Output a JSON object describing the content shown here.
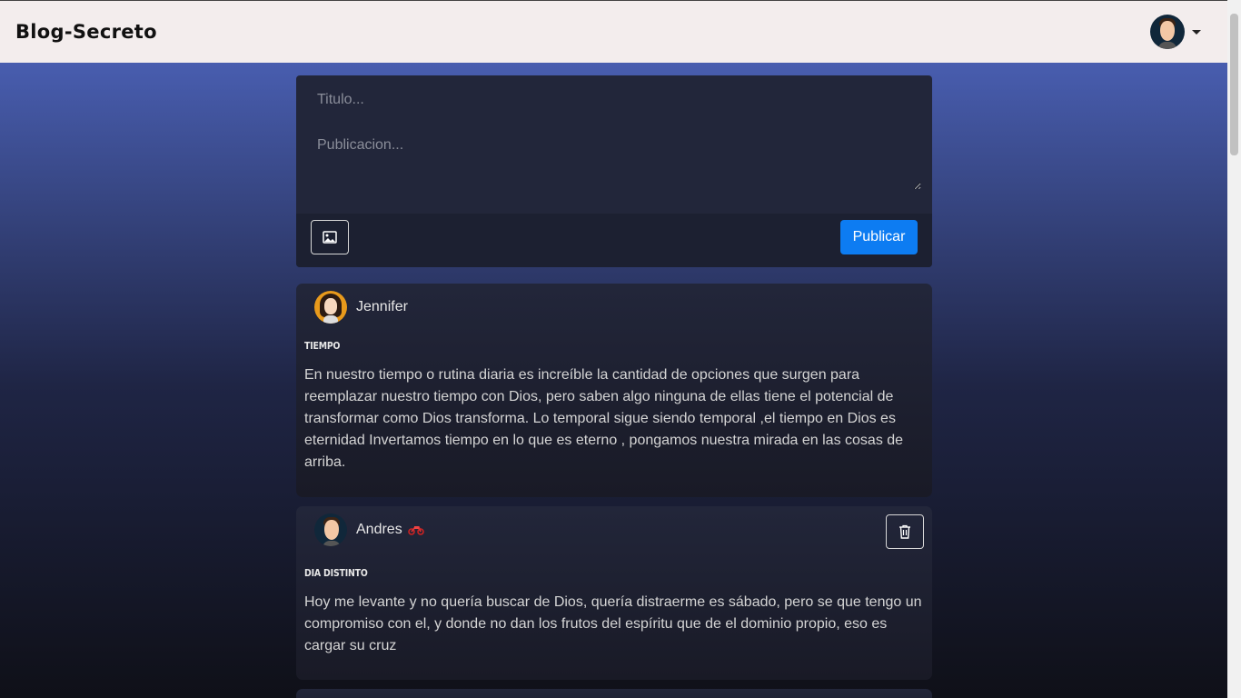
{
  "app": {
    "brand": "Blog-Secreto"
  },
  "composer": {
    "title_placeholder": "Titulo...",
    "body_placeholder": "Publicacion...",
    "publish_label": "Publicar"
  },
  "posts": [
    {
      "author": "Jennifer",
      "title": "TIEMPO",
      "body": "En nuestro tiempo o rutina diaria es increíble la cantidad de opciones que surgen para reemplazar nuestro tiempo con Dios, pero saben algo ninguna de ellas tiene el potencial de transformar como Dios transforma. Lo temporal sigue siendo temporal ,el tiempo en Dios es eternidad Invertamos tiempo en lo que es eterno , pongamos nuestra mirada en las cosas de arriba."
    },
    {
      "author": "Andres",
      "title": "DIA DISTINTO",
      "body": "Hoy me levante y no quería buscar de Dios, quería distraerme es sábado, pero se que tengo un compromiso con el, y donde no dan los frutos del espíritu que de el dominio propio, eso es cargar su cruz"
    }
  ],
  "colors": {
    "accent": "#0d7cf2",
    "navbar": "#f3eded"
  }
}
